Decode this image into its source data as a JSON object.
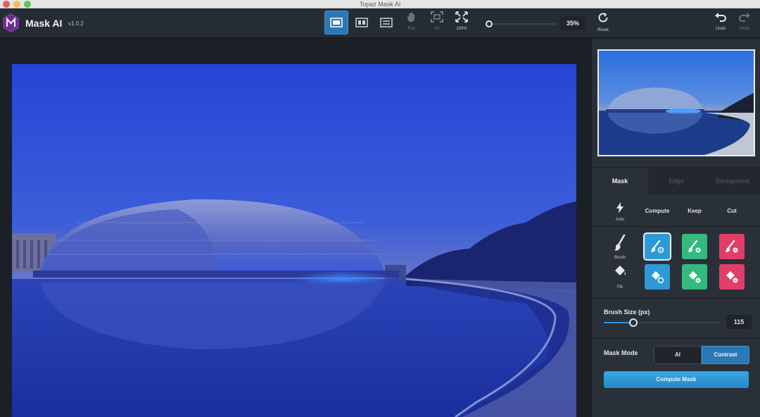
{
  "window": {
    "title": "Topaz Mask AI"
  },
  "app": {
    "name": "Mask AI",
    "version": "v1.0.2"
  },
  "toolbar": {
    "pan_label": "Pan",
    "fit_label": "Fit",
    "zoom100_label": "100%",
    "zoom_value": "35%",
    "reset_label": "Reset",
    "undo_label": "Undo",
    "redo_label": "Redo"
  },
  "panel": {
    "tabs": [
      {
        "label": "Mask",
        "active": true
      },
      {
        "label": "Edge",
        "active": false
      },
      {
        "label": "Background",
        "active": false
      }
    ],
    "columns": {
      "compute": "Compute",
      "keep": "Keep",
      "cut": "Cut"
    },
    "auto_label": "Auto",
    "brush_label": "Brush",
    "fill_label": "Fill",
    "brush_size": {
      "label": "Brush Size (px)",
      "value": "115",
      "fraction": 0.25
    },
    "mask_mode": {
      "label": "Mask Mode",
      "options": [
        "AI",
        "Contrast"
      ],
      "selected": "Contrast"
    },
    "compute_button": "Compute Mask"
  },
  "colors": {
    "accent": "#2b78b5",
    "compute": "#2b9ad6",
    "keep": "#35b97f",
    "cut": "#e23e6a"
  }
}
